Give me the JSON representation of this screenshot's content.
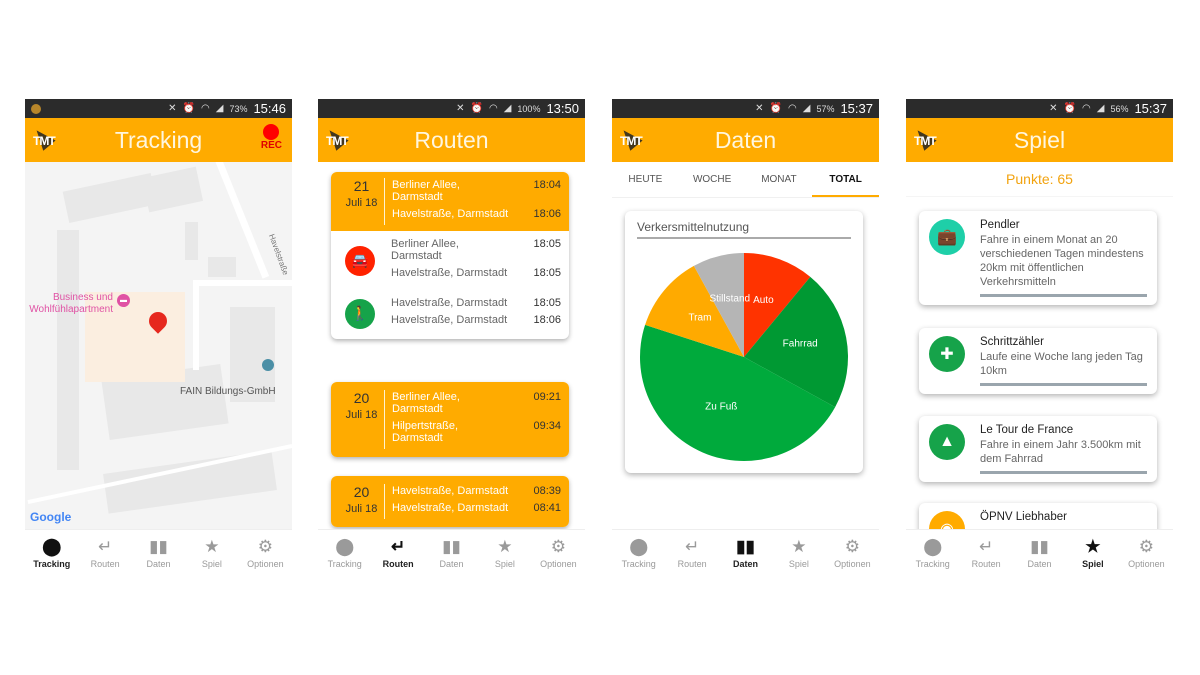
{
  "colors": {
    "accent": "#ffab00",
    "rec": "#ff0000",
    "auto": "#ff3300",
    "fahrrad": "#009933",
    "zufuss": "#00aa3c",
    "tram": "#ffaa00",
    "stillstand": "#b5b5b5",
    "punkte": "#f2a30f"
  },
  "nav": {
    "items": [
      {
        "label": "Tracking",
        "icon": "location-pin-icon"
      },
      {
        "label": "Routen",
        "icon": "return-arrow-icon"
      },
      {
        "label": "Daten",
        "icon": "bar-chart-icon"
      },
      {
        "label": "Spiel",
        "icon": "star-icon"
      },
      {
        "label": "Optionen",
        "icon": "gear-icon"
      }
    ]
  },
  "logo": "TMT",
  "screens": {
    "tracking": {
      "status": {
        "battery": "73%",
        "time": "15:46"
      },
      "title": "Tracking",
      "rec_label": "REC",
      "map": {
        "street": "Havelstraße",
        "poi1": "Business und Wohlfühlapartment",
        "poi1a": "Business und",
        "poi1b": "Wohlfühlapartment",
        "poi2": "FAIN Bildungs-GmbH",
        "attribution": "Google"
      }
    },
    "routen": {
      "status": {
        "battery": "100%",
        "time": "13:50"
      },
      "title": "Routen",
      "routes": [
        {
          "day": "21",
          "month": "Juli 18",
          "from": "Berliner Allee, Darmstadt",
          "from_time": "18:04",
          "to": "Havelstraße, Darmstadt",
          "to_time": "18:06",
          "segments": [
            {
              "mode": "car",
              "from": "Berliner Allee, Darmstadt",
              "from_time": "18:05",
              "to": "Havelstraße, Darmstadt",
              "to_time": "18:05"
            },
            {
              "mode": "walk",
              "from": "Havelstraße, Darmstadt",
              "from_time": "18:05",
              "to": "Havelstraße, Darmstadt",
              "to_time": "18:06"
            }
          ]
        },
        {
          "day": "20",
          "month": "Juli 18",
          "from": "Berliner Allee, Darmstadt",
          "from_time": "09:21",
          "to": "Hilpertstraße, Darmstadt",
          "to_time": "09:34"
        },
        {
          "day": "20",
          "month": "Juli 18",
          "from": "Havelstraße, Darmstadt",
          "from_time": "08:39",
          "to": "Havelstraße, Darmstadt",
          "to_time": "08:41"
        }
      ]
    },
    "daten": {
      "status": {
        "battery": "57%",
        "time": "15:37"
      },
      "title": "Daten",
      "tabs": [
        "HEUTE",
        "WOCHE",
        "MONAT",
        "TOTAL"
      ],
      "active_tab": "TOTAL",
      "card_title": "Verkersmittelnutzung"
    },
    "spiel": {
      "status": {
        "battery": "56%",
        "time": "15:37"
      },
      "title": "Spiel",
      "punkte": "Punkte: 65",
      "achievements": [
        {
          "title": "Pendler",
          "desc": "Fahre in einem Monat an 20 verschiedenen Tagen mindestens 20km mit öffentlichen Verkehrsmitteln",
          "icon": "briefcase-icon",
          "color": "#1ecfa8"
        },
        {
          "title": "Schrittzähler",
          "desc": "Laufe eine Woche lang jeden Tag 10km",
          "icon": "dumbbell-icon",
          "color": "#16a34a"
        },
        {
          "title": "Le Tour de France",
          "desc": "Fahre in einem Jahr 3.500km mit dem Fahrrad",
          "icon": "mountain-icon",
          "color": "#16a34a"
        },
        {
          "title": "ÖPNV Liebhaber",
          "desc": "",
          "icon": "bus-icon",
          "color": "#ffab00"
        }
      ]
    }
  },
  "chart_data": {
    "type": "pie",
    "title": "Verkersmittelnutzung",
    "categories": [
      "Auto",
      "Fahrrad",
      "Zu Fuß",
      "Tram",
      "Stillstand"
    ],
    "values": [
      11,
      22,
      47,
      12,
      8
    ],
    "colors": [
      "#ff3300",
      "#009933",
      "#00aa3c",
      "#ffaa00",
      "#b5b5b5"
    ],
    "start": "top, clockwise"
  }
}
